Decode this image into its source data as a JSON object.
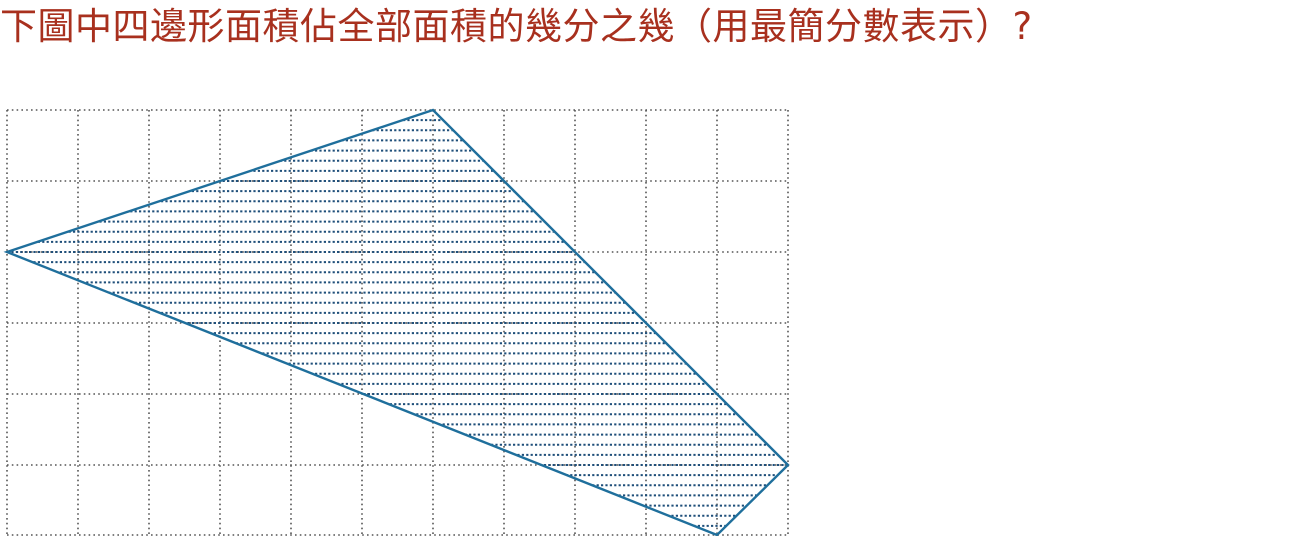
{
  "question": {
    "text": "下圖中四邊形面積佔全部面積的幾分之幾（用最簡分數表示）?",
    "color": "#a8301e"
  },
  "grid": {
    "columns": 11,
    "rows": 6,
    "line_color": "#555555"
  },
  "quadrilateral": {
    "vertices": [
      [
        0,
        2
      ],
      [
        6,
        0
      ],
      [
        11,
        5
      ],
      [
        10,
        6
      ]
    ],
    "stroke_color": "#1f6f9c",
    "hatch_color": "#1f4f7a",
    "hatch_lines_per_cell": 7
  }
}
